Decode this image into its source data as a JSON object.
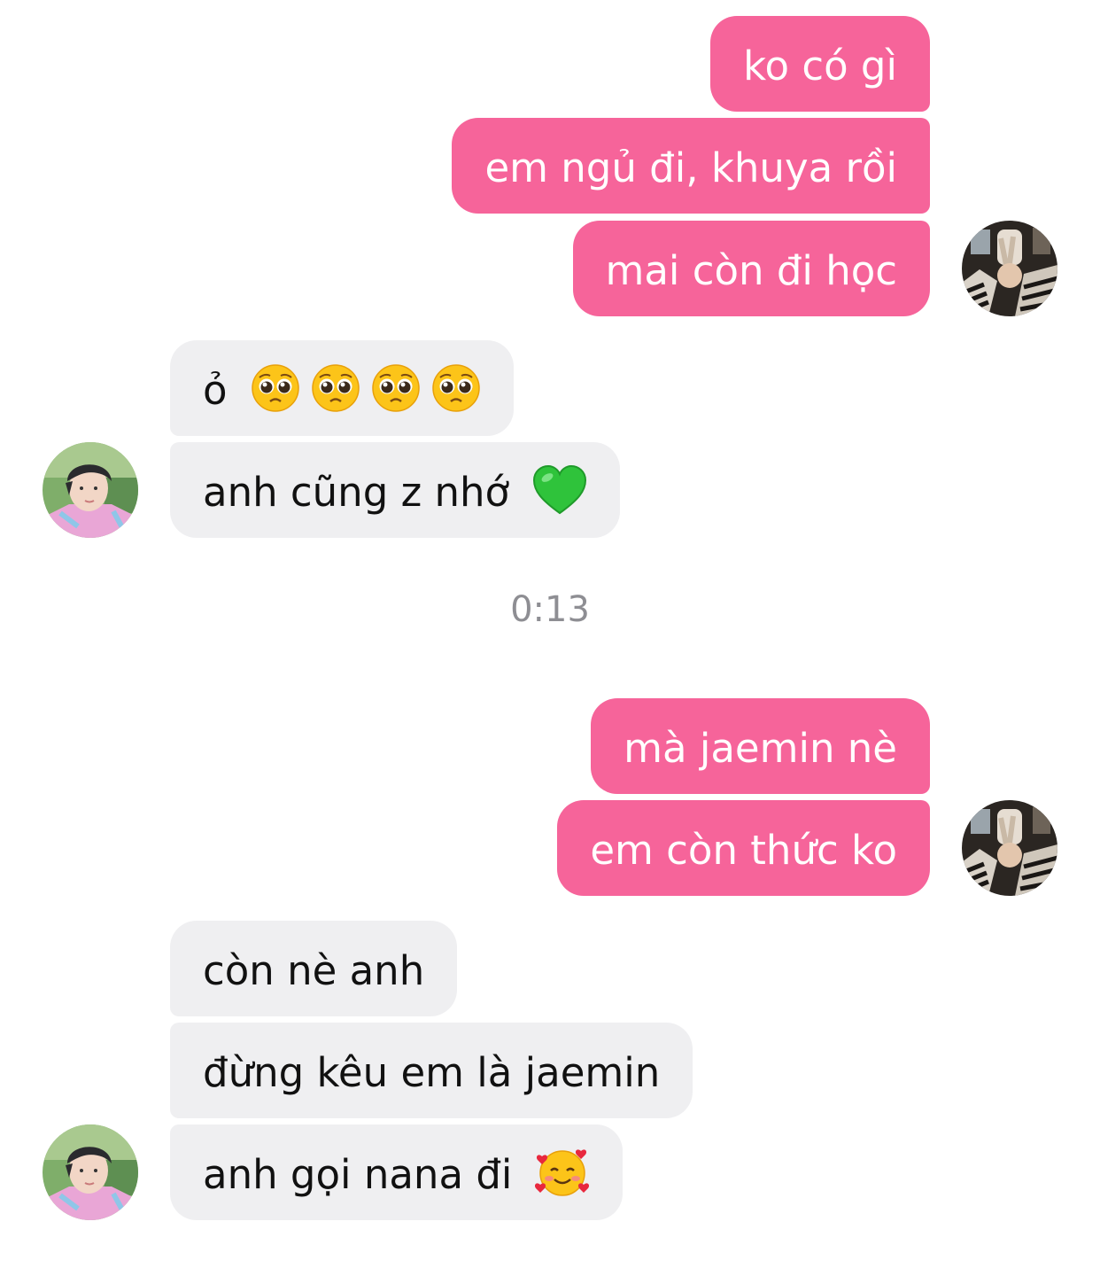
{
  "messages": {
    "sent_group_1": [
      "ko có gì",
      "em ngủ đi, khuya rồi",
      "mai còn đi học"
    ],
    "received_group_1": {
      "line1_text": "ỏ",
      "line1_emojis": [
        "pleading-face-emoji",
        "pleading-face-emoji",
        "pleading-face-emoji",
        "pleading-face-emoji"
      ],
      "line2_text": "anh cũng z nhớ",
      "line2_emoji": "green-heart-emoji"
    },
    "timestamp": "0:13",
    "sent_group_2": [
      "mà jaemin nè",
      "em còn thức ko"
    ],
    "received_group_2": {
      "line1_text": "còn nè anh",
      "line2_text": "đừng kêu em là jaemin",
      "line3_text": "anh gọi nana đi",
      "line3_emoji": "smiling-face-with-hearts-emoji"
    }
  },
  "colors": {
    "sent_bubble": "#f6649a",
    "received_bubble": "#efeff1",
    "timestamp": "#8e8e93"
  },
  "avatars": {
    "me": "user-avatar",
    "other": "contact-avatar"
  }
}
